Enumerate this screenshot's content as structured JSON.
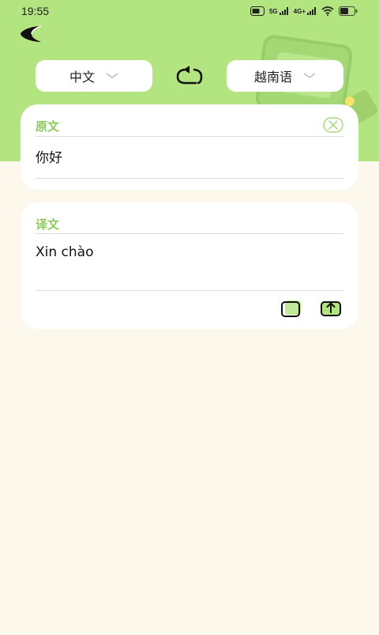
{
  "status_bar": {
    "time": "19:55",
    "signal_1": "5G",
    "signal_2": "4G+"
  },
  "header": {
    "source_lang": "中文",
    "target_lang": "越南语"
  },
  "source_card": {
    "title": "原文",
    "text": "你好"
  },
  "result_card": {
    "title": "译文",
    "text": "Xin  chào"
  },
  "colors": {
    "accent": "#b2e480",
    "title_green": "#8cc85a",
    "background": "#fdf8ec"
  }
}
